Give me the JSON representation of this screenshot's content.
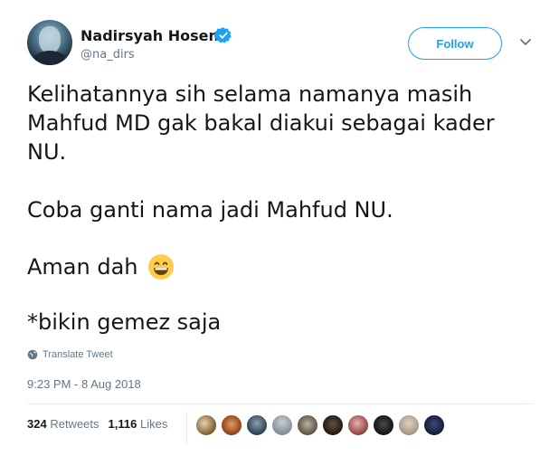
{
  "author": {
    "name": "Nadirsyah Hosen",
    "handle": "@na_dirs"
  },
  "follow_label": "Follow",
  "tweet": {
    "line1": "Kelihatannya sih selama namanya masih",
    "line2": "Mahfud MD gak bakal diakui sebagai kader",
    "line3": "NU.",
    "para2": "Coba ganti nama jadi Mahfud NU.",
    "para3": "Aman dah",
    "para4": "*bikin gemez saja"
  },
  "translate_label": "Translate Tweet",
  "timestamp": "9:23 PM - 8 Aug 2018",
  "stats": {
    "retweets": "324",
    "retweets_label": "Retweets",
    "likes": "1,116",
    "likes_label": "Likes"
  },
  "colors": {
    "accent": "#1da1f2",
    "text": "#14171a",
    "muted": "#657786"
  },
  "likers": [
    "liker-avatar",
    "liker-avatar",
    "liker-avatar",
    "liker-avatar",
    "liker-avatar",
    "liker-avatar",
    "liker-avatar",
    "liker-avatar",
    "liker-avatar",
    "liker-avatar"
  ]
}
